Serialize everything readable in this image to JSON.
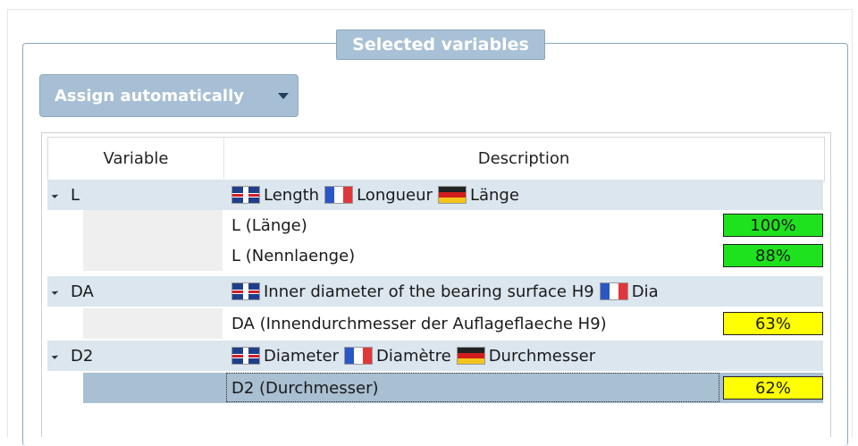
{
  "group": {
    "title": "Selected variables"
  },
  "assign": {
    "label": "Assign automatically"
  },
  "columns": {
    "variable": "Variable",
    "description": "Description"
  },
  "colors": {
    "green": "#1fe21f",
    "yellow": "#ffff00",
    "parent_row": "#dbe6ef",
    "selected_row": "#a9bfd2"
  },
  "rows": [
    {
      "name": "L",
      "desc": {
        "en": "Length",
        "fr": "Longueur",
        "de": "Länge"
      },
      "children": [
        {
          "label": "L (Länge)",
          "score": "100%"
        },
        {
          "label": "L (Nennlaenge)",
          "score": "88%"
        }
      ]
    },
    {
      "name": "DA",
      "desc": {
        "en": "Inner diameter of the bearing surface H9",
        "fr": "Dia"
      },
      "children": [
        {
          "label": "DA (Innendurchmesser der Auflageflaeche H9)",
          "score": "63%"
        }
      ]
    },
    {
      "name": "D2",
      "desc": {
        "en": "Diameter",
        "fr": "Diamètre",
        "de": "Durchmesser"
      },
      "children": [
        {
          "label": "D2 (Durchmesser)",
          "score": "62%"
        }
      ]
    }
  ]
}
